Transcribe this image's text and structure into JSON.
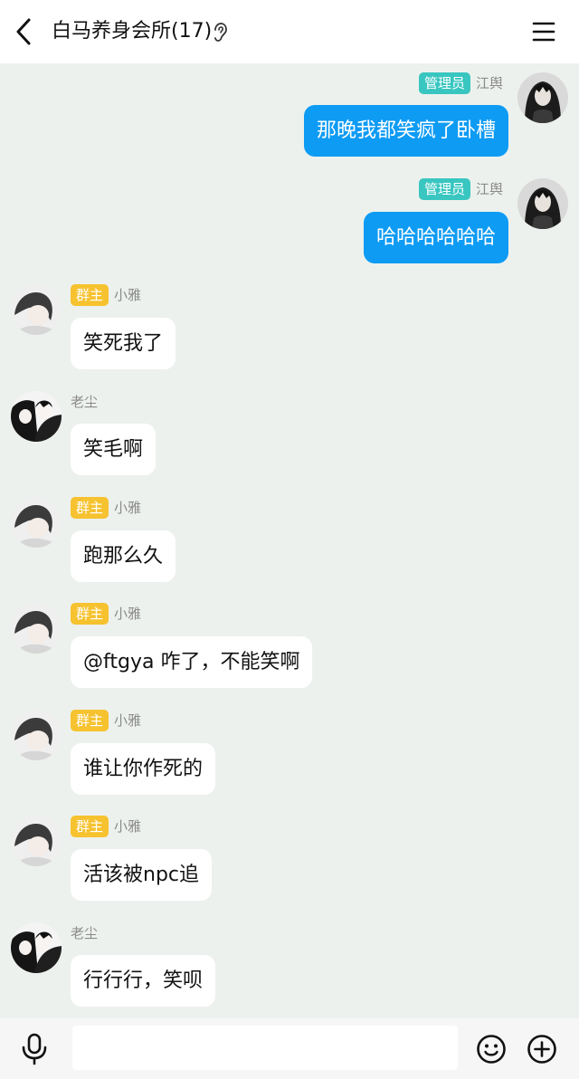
{
  "header": {
    "title": "白马养身会所(17)",
    "back_icon": "chevron-left-icon",
    "ear_icon": "ear-icon",
    "menu_icon": "hamburger-menu-icon"
  },
  "messages": [
    {
      "direction": "out",
      "badge": "管理员",
      "sender": "江舆",
      "text": "那晚我都笑疯了卧槽"
    },
    {
      "direction": "out",
      "badge": "管理员",
      "sender": "江舆",
      "text": "哈哈哈哈哈哈"
    },
    {
      "direction": "in",
      "badge": "群主",
      "sender": "小雅",
      "text": "笑死我了"
    },
    {
      "direction": "in",
      "badge": "",
      "sender": "老尘",
      "text": "笑毛啊"
    },
    {
      "direction": "in",
      "badge": "群主",
      "sender": "小雅",
      "text": "跑那么久"
    },
    {
      "direction": "in",
      "badge": "群主",
      "sender": "小雅",
      "text": "@ftgya 咋了，不能笑啊"
    },
    {
      "direction": "in",
      "badge": "群主",
      "sender": "小雅",
      "text": "谁让你作死的"
    },
    {
      "direction": "in",
      "badge": "群主",
      "sender": "小雅",
      "text": "活该被npc追"
    },
    {
      "direction": "in",
      "badge": "",
      "sender": "老尘",
      "text": "行行行，笑呗"
    }
  ],
  "input": {
    "placeholder": "",
    "value": ""
  },
  "colors": {
    "background": "#edf1ed",
    "outgoing_bubble": "#0e9bf4",
    "admin_badge": "#39c6c0",
    "owner_badge": "#f6c22f"
  }
}
